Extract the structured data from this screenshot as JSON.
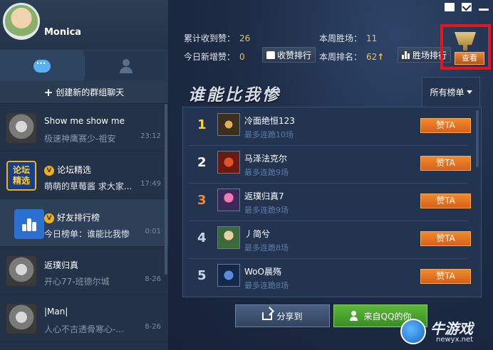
{
  "profile": {
    "username": "Monica"
  },
  "sidebar": {
    "create_group_label": "创建新的群组聊天",
    "conversations": [
      {
        "name": "Show me show me",
        "message": "极速神鹰赛少-祖安",
        "time": "23:12"
      },
      {
        "name": "论坛精选",
        "avatar_text": [
          "论坛",
          "精选"
        ],
        "message": "萌萌的草莓酱 求大家...",
        "time": "17:49",
        "vip": "V"
      },
      {
        "name": "好友排行榜",
        "message": "今日榜单：谁能比我惨",
        "time": "0:01",
        "vip": "V"
      },
      {
        "name": "返璞归真",
        "message": "开心77-班德尔城",
        "time": "8-26"
      },
      {
        "name": "|Man|",
        "message": "人心不古透骨寒心-...",
        "time": "8-26"
      }
    ]
  },
  "stats": {
    "total_likes_label": "累计收到赞：",
    "total_likes": "26",
    "weekly_wins_label": "本周胜场：",
    "weekly_wins": "11",
    "new_likes_label": "今日新增赞：",
    "new_likes": "0",
    "weekly_rank_label": "本周排名：",
    "weekly_rank": "62",
    "likes_rank_button": "收赞排行",
    "wins_rank_button": "胜场排行"
  },
  "view_button": "查看",
  "title": "谁能比我惨",
  "filter_label": "所有榜单",
  "leaderboard": [
    {
      "rank": "1",
      "name": "冷面绝恒123",
      "streak": "最多连跪10场",
      "button": "赞TA"
    },
    {
      "rank": "2",
      "name": "马泽法克尔",
      "streak": "最多连跪9场",
      "button": "赞TA"
    },
    {
      "rank": "3",
      "name": "返璞归真7",
      "streak": "最多连跪9场",
      "button": "赞TA"
    },
    {
      "rank": "4",
      "name": "丿简兮",
      "streak": "最多连跪8场",
      "button": "赞TA"
    },
    {
      "rank": "5",
      "name": "WoO晨殇",
      "streak": "最多连跪8场",
      "button": "赞TA"
    }
  ],
  "buttons": {
    "share": "分享到",
    "from_qq": "来自QQ的你"
  },
  "watermark": {
    "title": "牛游戏",
    "url": "newyx.net"
  }
}
